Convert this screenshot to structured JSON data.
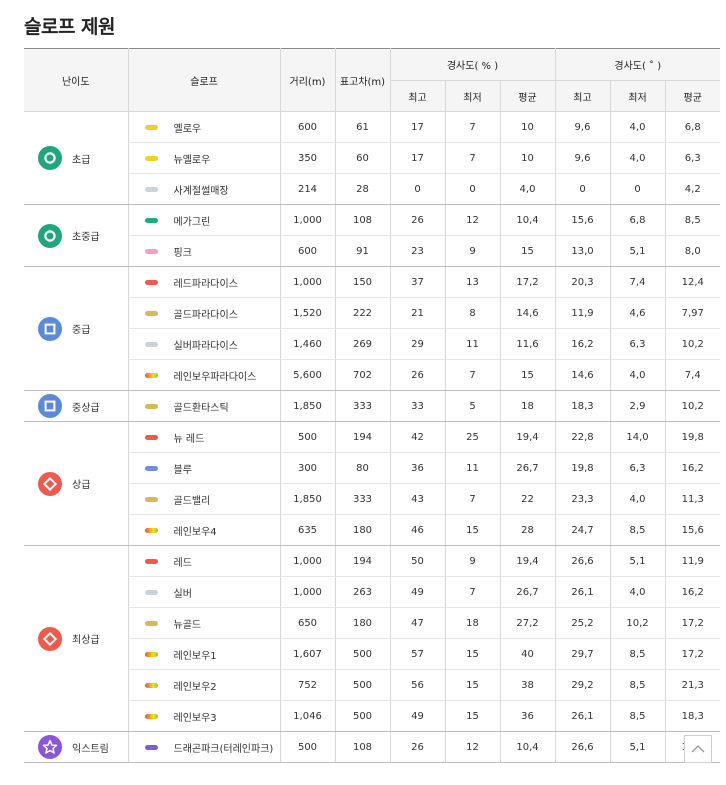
{
  "page": {
    "title": "슬로프 제원"
  },
  "colors": {
    "beginner": "#1ea77f",
    "intermediate": "#5b8bd8",
    "advanced": "#ef5a4d",
    "extreme": "#8a55d9",
    "header_bg": "#f5f5f5"
  },
  "table": {
    "headers": {
      "level": "난이도",
      "slope": "슬로프",
      "distance": "거리(m)",
      "elevation": "표고차(m)",
      "grade_percent": "경사도( % )",
      "grade_degree": "경사도( ˚ )",
      "max": "최고",
      "min": "최저",
      "avg": "평균"
    },
    "groups": [
      {
        "level": "초급",
        "icon": "circle",
        "color": "#1ea77f",
        "rows": [
          {
            "name": "옐로우",
            "dot": "#f2d028",
            "distance": "600",
            "elevation": "61",
            "pmax": "17",
            "pmin": "7",
            "pavg": "10",
            "dmax": "9,6",
            "dmin": "4,0",
            "davg": "6,8"
          },
          {
            "name": "뉴옐로우",
            "dot": "#f2d028",
            "distance": "350",
            "elevation": "60",
            "pmax": "17",
            "pmin": "7",
            "pavg": "10",
            "dmax": "9,6",
            "dmin": "4,0",
            "davg": "6,3"
          },
          {
            "name": "사계절썰매장",
            "dot": "#c9d3dc",
            "distance": "214",
            "elevation": "28",
            "pmax": "0",
            "pmin": "0",
            "pavg": "4,0",
            "dmax": "0",
            "dmin": "0",
            "davg": "4,2"
          }
        ]
      },
      {
        "level": "초중급",
        "icon": "circle",
        "color": "#1ea77f",
        "rows": [
          {
            "name": "메가그린",
            "dot": "#1bb07b",
            "distance": "1,000",
            "elevation": "108",
            "pmax": "26",
            "pmin": "12",
            "pavg": "10,4",
            "dmax": "15,6",
            "dmin": "6,8",
            "davg": "8,5"
          },
          {
            "name": "핑크",
            "dot": "#f4a1c0",
            "distance": "600",
            "elevation": "91",
            "pmax": "23",
            "pmin": "9",
            "pavg": "15",
            "dmax": "13,0",
            "dmin": "5,1",
            "davg": "8,0"
          }
        ]
      },
      {
        "level": "중급",
        "icon": "square",
        "color": "#5b8bd8",
        "rows": [
          {
            "name": "레드파라다이스",
            "dot": "#ef5a4d",
            "distance": "1,000",
            "elevation": "150",
            "pmax": "37",
            "pmin": "13",
            "pavg": "17,2",
            "dmax": "20,3",
            "dmin": "7,4",
            "davg": "12,4"
          },
          {
            "name": "골드파라다이스",
            "dot": "#d9b85a",
            "distance": "1,520",
            "elevation": "222",
            "pmax": "21",
            "pmin": "8",
            "pavg": "14,6",
            "dmax": "11,9",
            "dmin": "4,6",
            "davg": "7,97"
          },
          {
            "name": "실버파라다이스",
            "dot": "#c9d3dc",
            "distance": "1,460",
            "elevation": "269",
            "pmax": "29",
            "pmin": "11",
            "pavg": "11,6",
            "dmax": "16,2",
            "dmin": "6,3",
            "davg": "10,2"
          },
          {
            "name": "레인보우파라다이스",
            "dot": "rainbow",
            "distance": "5,600",
            "elevation": "702",
            "pmax": "26",
            "pmin": "7",
            "pavg": "15",
            "dmax": "14,6",
            "dmin": "4,0",
            "davg": "7,4"
          }
        ]
      },
      {
        "level": "중상급",
        "icon": "square",
        "color": "#5b8bd8",
        "rows": [
          {
            "name": "골드환타스틱",
            "dot": "#d9b85a",
            "distance": "1,850",
            "elevation": "333",
            "pmax": "33",
            "pmin": "5",
            "pavg": "18",
            "dmax": "18,3",
            "dmin": "2,9",
            "davg": "10,2"
          }
        ]
      },
      {
        "level": "상급",
        "icon": "diamond",
        "color": "#ef5a4d",
        "rows": [
          {
            "name": "뉴 레드",
            "dot": "#ef5a4d",
            "distance": "500",
            "elevation": "194",
            "pmax": "42",
            "pmin": "25",
            "pavg": "19,4",
            "dmax": "22,8",
            "dmin": "14,0",
            "davg": "19,8"
          },
          {
            "name": "블루",
            "dot": "#6f8fdc",
            "distance": "300",
            "elevation": "80",
            "pmax": "36",
            "pmin": "11",
            "pavg": "26,7",
            "dmax": "19,8",
            "dmin": "6,3",
            "davg": "16,2"
          },
          {
            "name": "골드밸리",
            "dot": "#d9b85a",
            "distance": "1,850",
            "elevation": "333",
            "pmax": "43",
            "pmin": "7",
            "pavg": "22",
            "dmax": "23,3",
            "dmin": "4,0",
            "davg": "11,3"
          },
          {
            "name": "레인보우4",
            "dot": "rainbow",
            "distance": "635",
            "elevation": "180",
            "pmax": "46",
            "pmin": "15",
            "pavg": "28",
            "dmax": "24,7",
            "dmin": "8,5",
            "davg": "15,6"
          }
        ]
      },
      {
        "level": "최상급",
        "icon": "diamond",
        "color": "#ef5a4d",
        "rows": [
          {
            "name": "레드",
            "dot": "#ef5a4d",
            "distance": "1,000",
            "elevation": "194",
            "pmax": "50",
            "pmin": "9",
            "pavg": "19,4",
            "dmax": "26,6",
            "dmin": "5,1",
            "davg": "11,9"
          },
          {
            "name": "실버",
            "dot": "#c9d3dc",
            "distance": "1,000",
            "elevation": "263",
            "pmax": "49",
            "pmin": "7",
            "pavg": "26,7",
            "dmax": "26,1",
            "dmin": "4,0",
            "davg": "16,2"
          },
          {
            "name": "뉴골드",
            "dot": "#d9b85a",
            "distance": "650",
            "elevation": "180",
            "pmax": "47",
            "pmin": "18",
            "pavg": "27,2",
            "dmax": "25,2",
            "dmin": "10,2",
            "davg": "17,2"
          },
          {
            "name": "레인보우1",
            "dot": "rainbow",
            "distance": "1,607",
            "elevation": "500",
            "pmax": "57",
            "pmin": "15",
            "pavg": "40",
            "dmax": "29,7",
            "dmin": "8,5",
            "davg": "17,2"
          },
          {
            "name": "레인보우2",
            "dot": "rainbow",
            "distance": "752",
            "elevation": "500",
            "pmax": "56",
            "pmin": "15",
            "pavg": "38",
            "dmax": "29,2",
            "dmin": "8,5",
            "davg": "21,3"
          },
          {
            "name": "레인보우3",
            "dot": "rainbow",
            "distance": "1,046",
            "elevation": "500",
            "pmax": "49",
            "pmin": "15",
            "pavg": "36",
            "dmax": "26,1",
            "dmin": "8,5",
            "davg": "18,3"
          }
        ]
      },
      {
        "level": "익스트림",
        "icon": "star",
        "color": "#8a55d9",
        "rows": [
          {
            "name": "드래곤파크(터레인파크)",
            "dot": "#7b5ed9",
            "distance": "500",
            "elevation": "108",
            "pmax": "26",
            "pmin": "12",
            "pavg": "10,4",
            "dmax": "26,6",
            "dmin": "5,1",
            "davg": "11,9"
          }
        ]
      }
    ]
  },
  "scroll_top": {
    "icon": "chevron-up-icon"
  }
}
